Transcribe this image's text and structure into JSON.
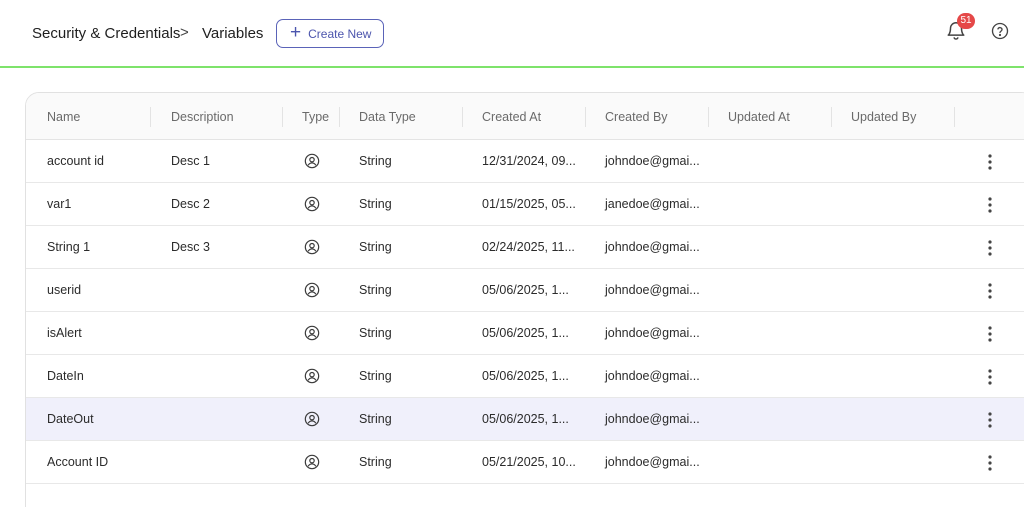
{
  "header": {
    "breadcrumb": [
      "Security & Credentials",
      "Variables"
    ],
    "separator": ">",
    "create_button": "Create New",
    "notifications_count": "51",
    "icons": {
      "notifications": "bell-icon",
      "help": "help-circle-icon",
      "create": "plus-icon"
    },
    "accent_color": "#7ee36b",
    "badge_color": "#e54848"
  },
  "table": {
    "columns": [
      "Name",
      "Description",
      "Type",
      "Data Type",
      "Created At",
      "Created By",
      "Updated At",
      "Updated By"
    ],
    "type_icon": "user-circle-icon",
    "row_action_icon": "more-vertical-icon",
    "selected_row": 6,
    "rows": [
      {
        "name": "account id",
        "description": "Desc 1",
        "data_type": "String",
        "created_at": "12/31/2024, 09...",
        "created_by": "johndoe@gmai...",
        "updated_at": "",
        "updated_by": ""
      },
      {
        "name": "var1",
        "description": "Desc 2",
        "data_type": "String",
        "created_at": "01/15/2025, 05...",
        "created_by": "janedoe@gmai...",
        "updated_at": "",
        "updated_by": ""
      },
      {
        "name": "String 1",
        "description": "Desc 3",
        "data_type": "String",
        "created_at": "02/24/2025, 11...",
        "created_by": "johndoe@gmai...",
        "updated_at": "",
        "updated_by": ""
      },
      {
        "name": "userid",
        "description": "",
        "data_type": "String",
        "created_at": "05/06/2025, 1...",
        "created_by": "johndoe@gmai...",
        "updated_at": "",
        "updated_by": ""
      },
      {
        "name": "isAlert",
        "description": "",
        "data_type": "String",
        "created_at": "05/06/2025, 1...",
        "created_by": "johndoe@gmai...",
        "updated_at": "",
        "updated_by": ""
      },
      {
        "name": "DateIn",
        "description": "",
        "data_type": "String",
        "created_at": "05/06/2025, 1...",
        "created_by": "johndoe@gmai...",
        "updated_at": "",
        "updated_by": ""
      },
      {
        "name": "DateOut",
        "description": "",
        "data_type": "String",
        "created_at": "05/06/2025, 1...",
        "created_by": "johndoe@gmai...",
        "updated_at": "",
        "updated_by": ""
      },
      {
        "name": "Account ID",
        "description": "",
        "data_type": "String",
        "created_at": "05/21/2025, 10...",
        "created_by": "johndoe@gmai...",
        "updated_at": "",
        "updated_by": ""
      }
    ]
  }
}
